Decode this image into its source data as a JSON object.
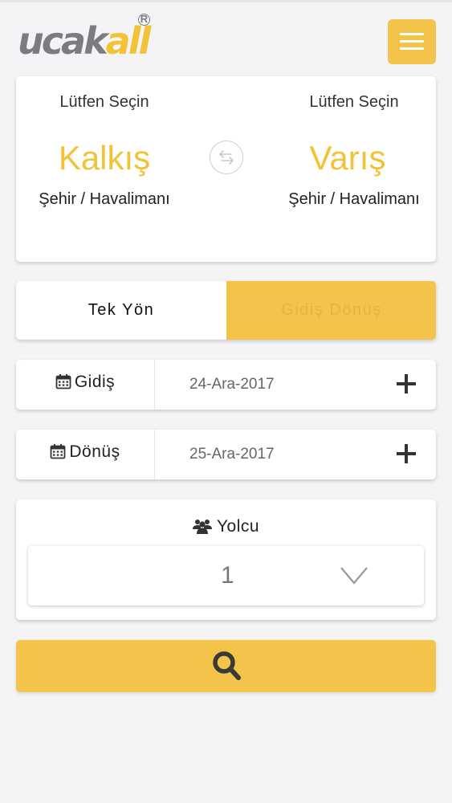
{
  "header": {
    "logo": {
      "part1": "u",
      "part2": "c",
      "part3": "ak",
      "part4": "all",
      "registered": "R"
    },
    "menu_icon": "hamburger-icon"
  },
  "route": {
    "from": {
      "hint": "Lütfen Seçin",
      "title": "Kalkış",
      "subtitle": "Şehir / Havalimanı"
    },
    "to": {
      "hint": "Lütfen Seçin",
      "title": "Varış",
      "subtitle": "Şehir / Havalimanı"
    },
    "swap_icon": "swap-arrows-icon"
  },
  "trip_type": {
    "one_way": "Tek Yön",
    "round_trip": "Gidiş Dönüş",
    "selected": "round_trip"
  },
  "dates": {
    "departure": {
      "label": "Gidiş",
      "value": "24-Ara-2017"
    },
    "return": {
      "label": "Dönüş",
      "value": "25-Ara-2017"
    }
  },
  "passengers": {
    "label": "Yolcu",
    "value": "1"
  },
  "search": {
    "icon": "search-icon"
  },
  "colors": {
    "accent": "#f4c44a",
    "accent_text": "#f2c336",
    "logo_grey": "#7b7c7f",
    "background": "#f4f4f6"
  }
}
